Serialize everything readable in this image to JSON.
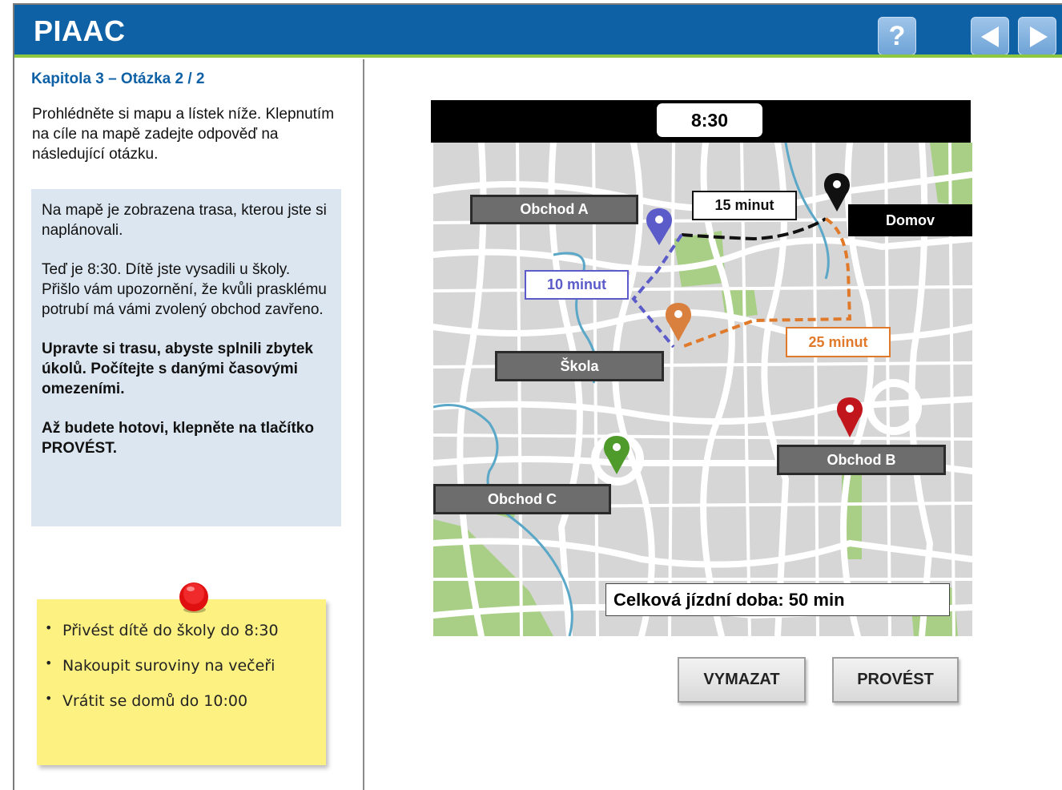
{
  "header": {
    "title": "PIAAC",
    "help_label": "?",
    "accent": "#0f61a6",
    "stripe_color": "#8dc63f"
  },
  "left_panel": {
    "chapter": "Kapitola 3 – Otázka 2 / 2",
    "instructions": "Prohlédněte si mapu a lístek níže. Klepnutím na cíle na mapě zadejte odpověď na následující otázku.",
    "task": {
      "p1": "Na mapě je zobrazena trasa, kterou jste si naplánovali.",
      "p2": "Teď je 8:30. Dítě jste vysadili u školy. Přišlo vám upozornění, že kvůli prasklému potrubí má vámi zvolený obchod zavřeno.",
      "p3": "Upravte si trasu, abyste splnili zbytek úkolů. Počítejte s danými časovými omezeními.",
      "p4": "Až budete hotovi, klepněte na tlačítko PROVÉST."
    },
    "note": {
      "items": [
        "Přivést dítě do školy do 8:30",
        "Nakoupit suroviny na večeři",
        "Vrátit se domů do 10:00"
      ]
    }
  },
  "map": {
    "clock": "8:30",
    "locations": {
      "shop_a": "Obchod A",
      "shop_b": "Obchod B",
      "shop_c": "Obchod C",
      "school": "Škola",
      "home": "Domov"
    },
    "legs": {
      "black": "15 minut",
      "blue": "10 minut",
      "orange": "25 minut"
    },
    "total": "Celková jízdní doba: 50 min",
    "colors": {
      "blue": "#5b5bc9",
      "orange": "#e07a2a",
      "black": "#111111",
      "red": "#c0161c",
      "green": "#4e9a2a",
      "orange_pin": "#d9803f"
    }
  },
  "buttons": {
    "clear": "VYMAZAT",
    "submit": "PROVÉST"
  }
}
